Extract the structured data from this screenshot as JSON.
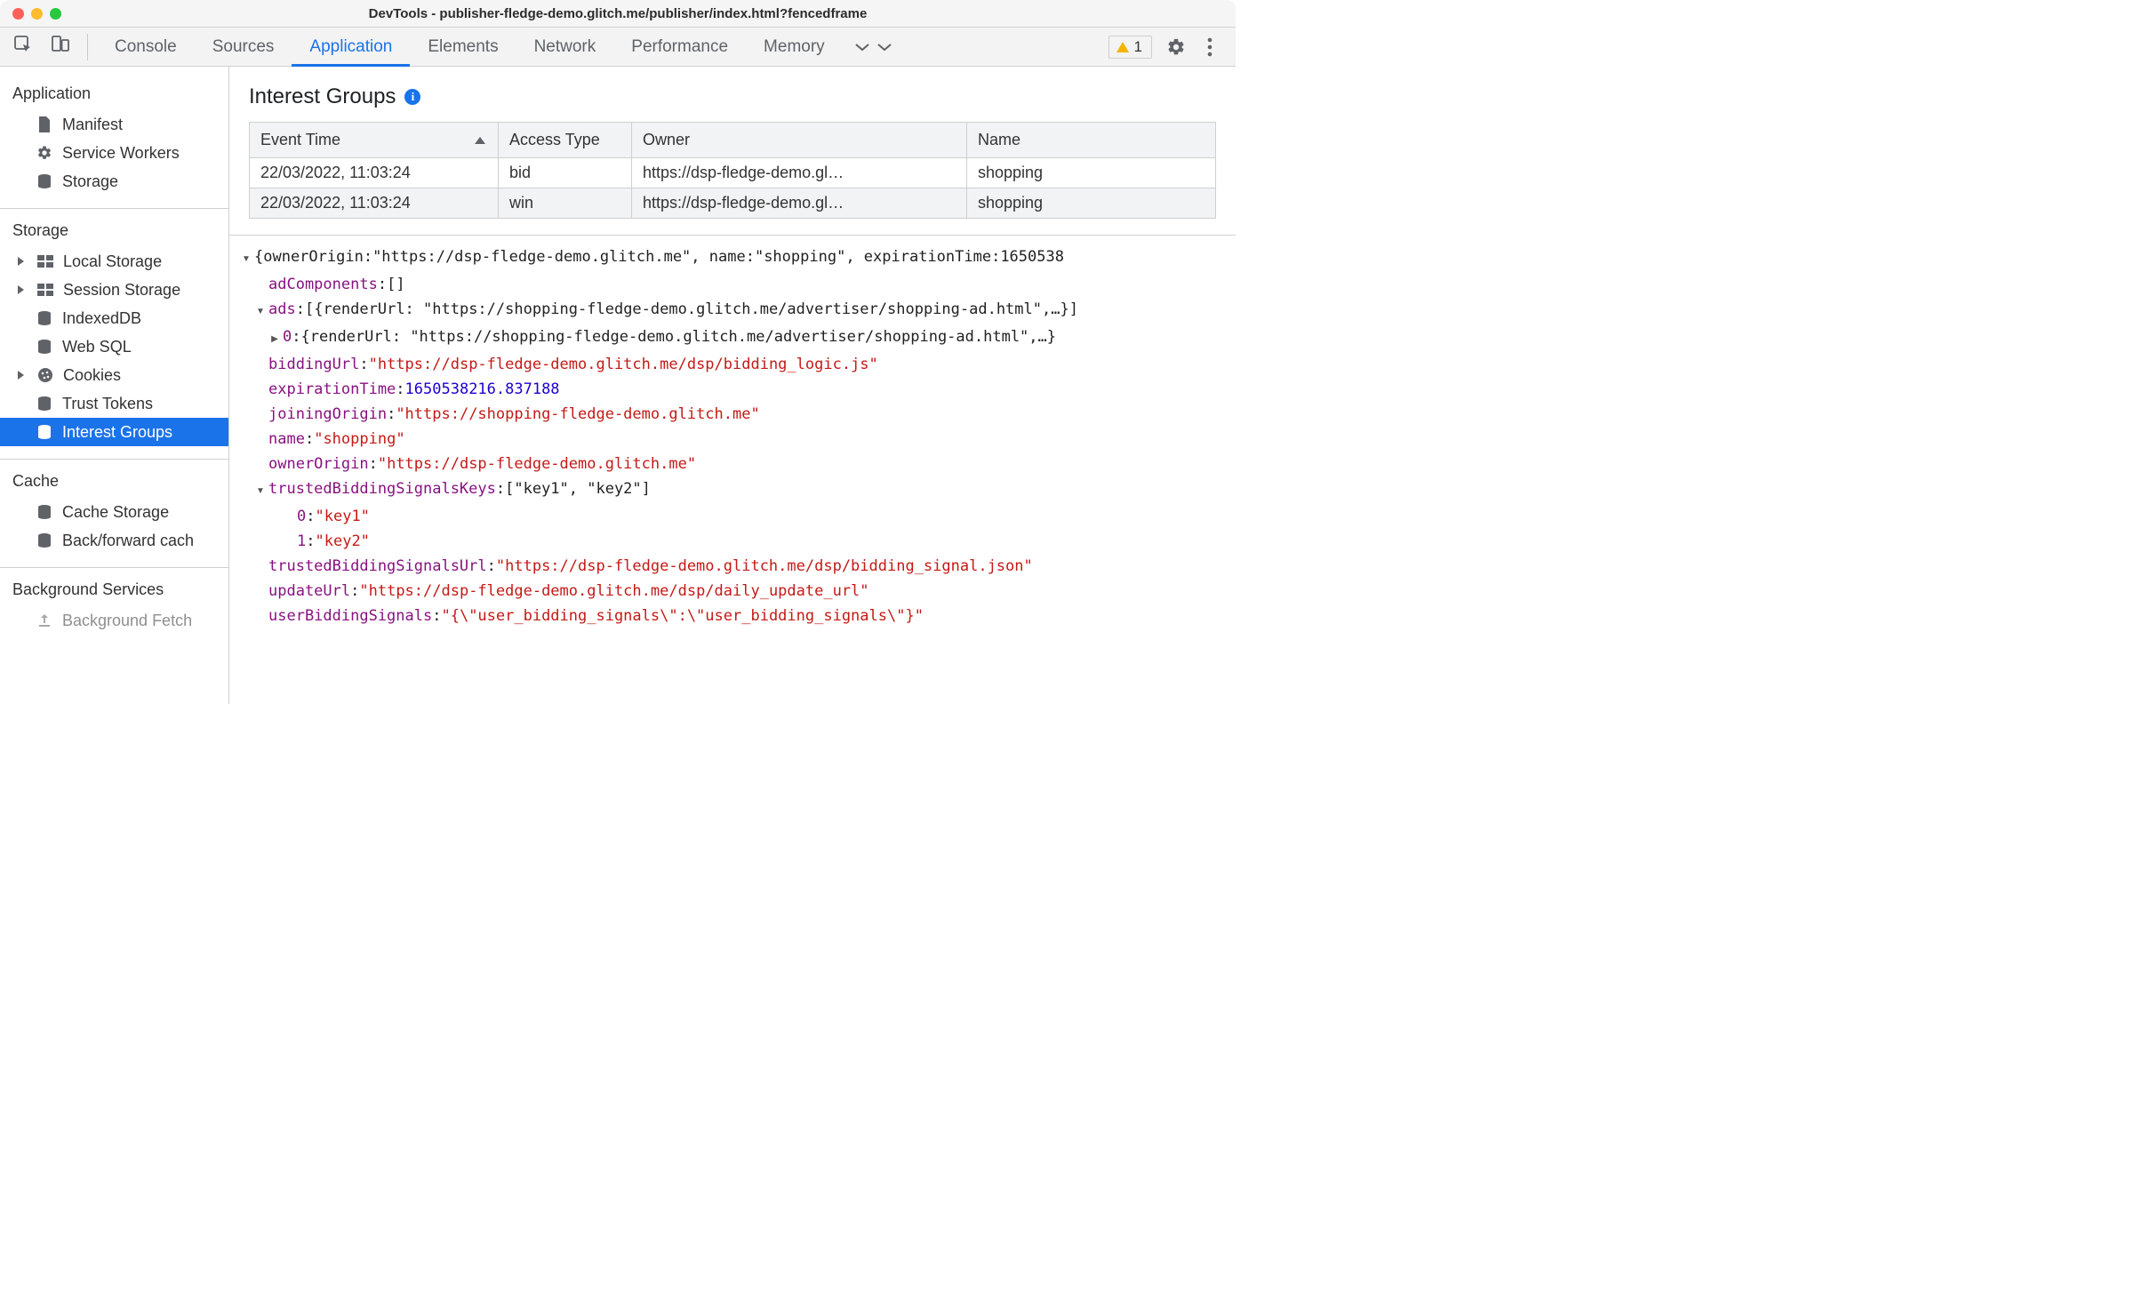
{
  "window": {
    "title": "DevTools - publisher-fledge-demo.glitch.me/publisher/index.html?fencedframe"
  },
  "tabs": {
    "items": [
      "Console",
      "Sources",
      "Application",
      "Elements",
      "Network",
      "Performance",
      "Memory"
    ],
    "active": "Application",
    "issues_count": "1"
  },
  "sidebar": {
    "sections": {
      "application": {
        "heading": "Application",
        "manifest": "Manifest",
        "service_workers": "Service Workers",
        "storage": "Storage"
      },
      "storage": {
        "heading": "Storage",
        "local_storage": "Local Storage",
        "session_storage": "Session Storage",
        "indexeddb": "IndexedDB",
        "web_sql": "Web SQL",
        "cookies": "Cookies",
        "trust_tokens": "Trust Tokens",
        "interest_groups": "Interest Groups"
      },
      "cache": {
        "heading": "Cache",
        "cache_storage": "Cache Storage",
        "bf_cache": "Back/forward cach"
      },
      "background": {
        "heading": "Background Services",
        "bg_fetch": "Background Fetch"
      }
    }
  },
  "main": {
    "title": "Interest Groups",
    "table": {
      "headers": [
        "Event Time",
        "Access Type",
        "Owner",
        "Name"
      ],
      "rows": [
        {
          "time": "22/03/2022, 11:03:24",
          "type": "bid",
          "owner": "https://dsp-fledge-demo.gl…",
          "name": "shopping"
        },
        {
          "time": "22/03/2022, 11:03:24",
          "type": "win",
          "owner": "https://dsp-fledge-demo.gl…",
          "name": "shopping"
        }
      ]
    },
    "detail": {
      "top_summary_prefix": "{ownerOrigin: ",
      "top_ownerOrigin": "\"https://dsp-fledge-demo.glitch.me\"",
      "top_name_label": ", name: ",
      "top_name_val": "\"shopping\"",
      "top_exp_label": ", expirationTime: ",
      "top_exp_val": "1650538",
      "adComponents_key": "adComponents",
      "adComponents_val": "[]",
      "ads_key": "ads",
      "ads_summary": "[{renderUrl: \"https://shopping-fledge-demo.glitch.me/advertiser/shopping-ad.html\",…}]",
      "ads0_prefix": "0",
      "ads0_summary": "{renderUrl: \"https://shopping-fledge-demo.glitch.me/advertiser/shopping-ad.html\",…}",
      "biddingUrl_key": "biddingUrl",
      "biddingUrl_val": "\"https://dsp-fledge-demo.glitch.me/dsp/bidding_logic.js\"",
      "expirationTime_key": "expirationTime",
      "expirationTime_val": "1650538216.837188",
      "joiningOrigin_key": "joiningOrigin",
      "joiningOrigin_val": "\"https://shopping-fledge-demo.glitch.me\"",
      "name_key": "name",
      "name_val": "\"shopping\"",
      "ownerOrigin_key": "ownerOrigin",
      "ownerOrigin_val": "\"https://dsp-fledge-demo.glitch.me\"",
      "tbsk_key": "trustedBiddingSignalsKeys",
      "tbsk_summary": "[\"key1\", \"key2\"]",
      "tbsk_0_key": "0",
      "tbsk_0_val": "\"key1\"",
      "tbsk_1_key": "1",
      "tbsk_1_val": "\"key2\"",
      "tbsu_key": "trustedBiddingSignalsUrl",
      "tbsu_val": "\"https://dsp-fledge-demo.glitch.me/dsp/bidding_signal.json\"",
      "updateUrl_key": "updateUrl",
      "updateUrl_val": "\"https://dsp-fledge-demo.glitch.me/dsp/daily_update_url\"",
      "ubs_key": "userBiddingSignals",
      "ubs_val": "\"{\\\"user_bidding_signals\\\":\\\"user_bidding_signals\\\"}\""
    }
  }
}
